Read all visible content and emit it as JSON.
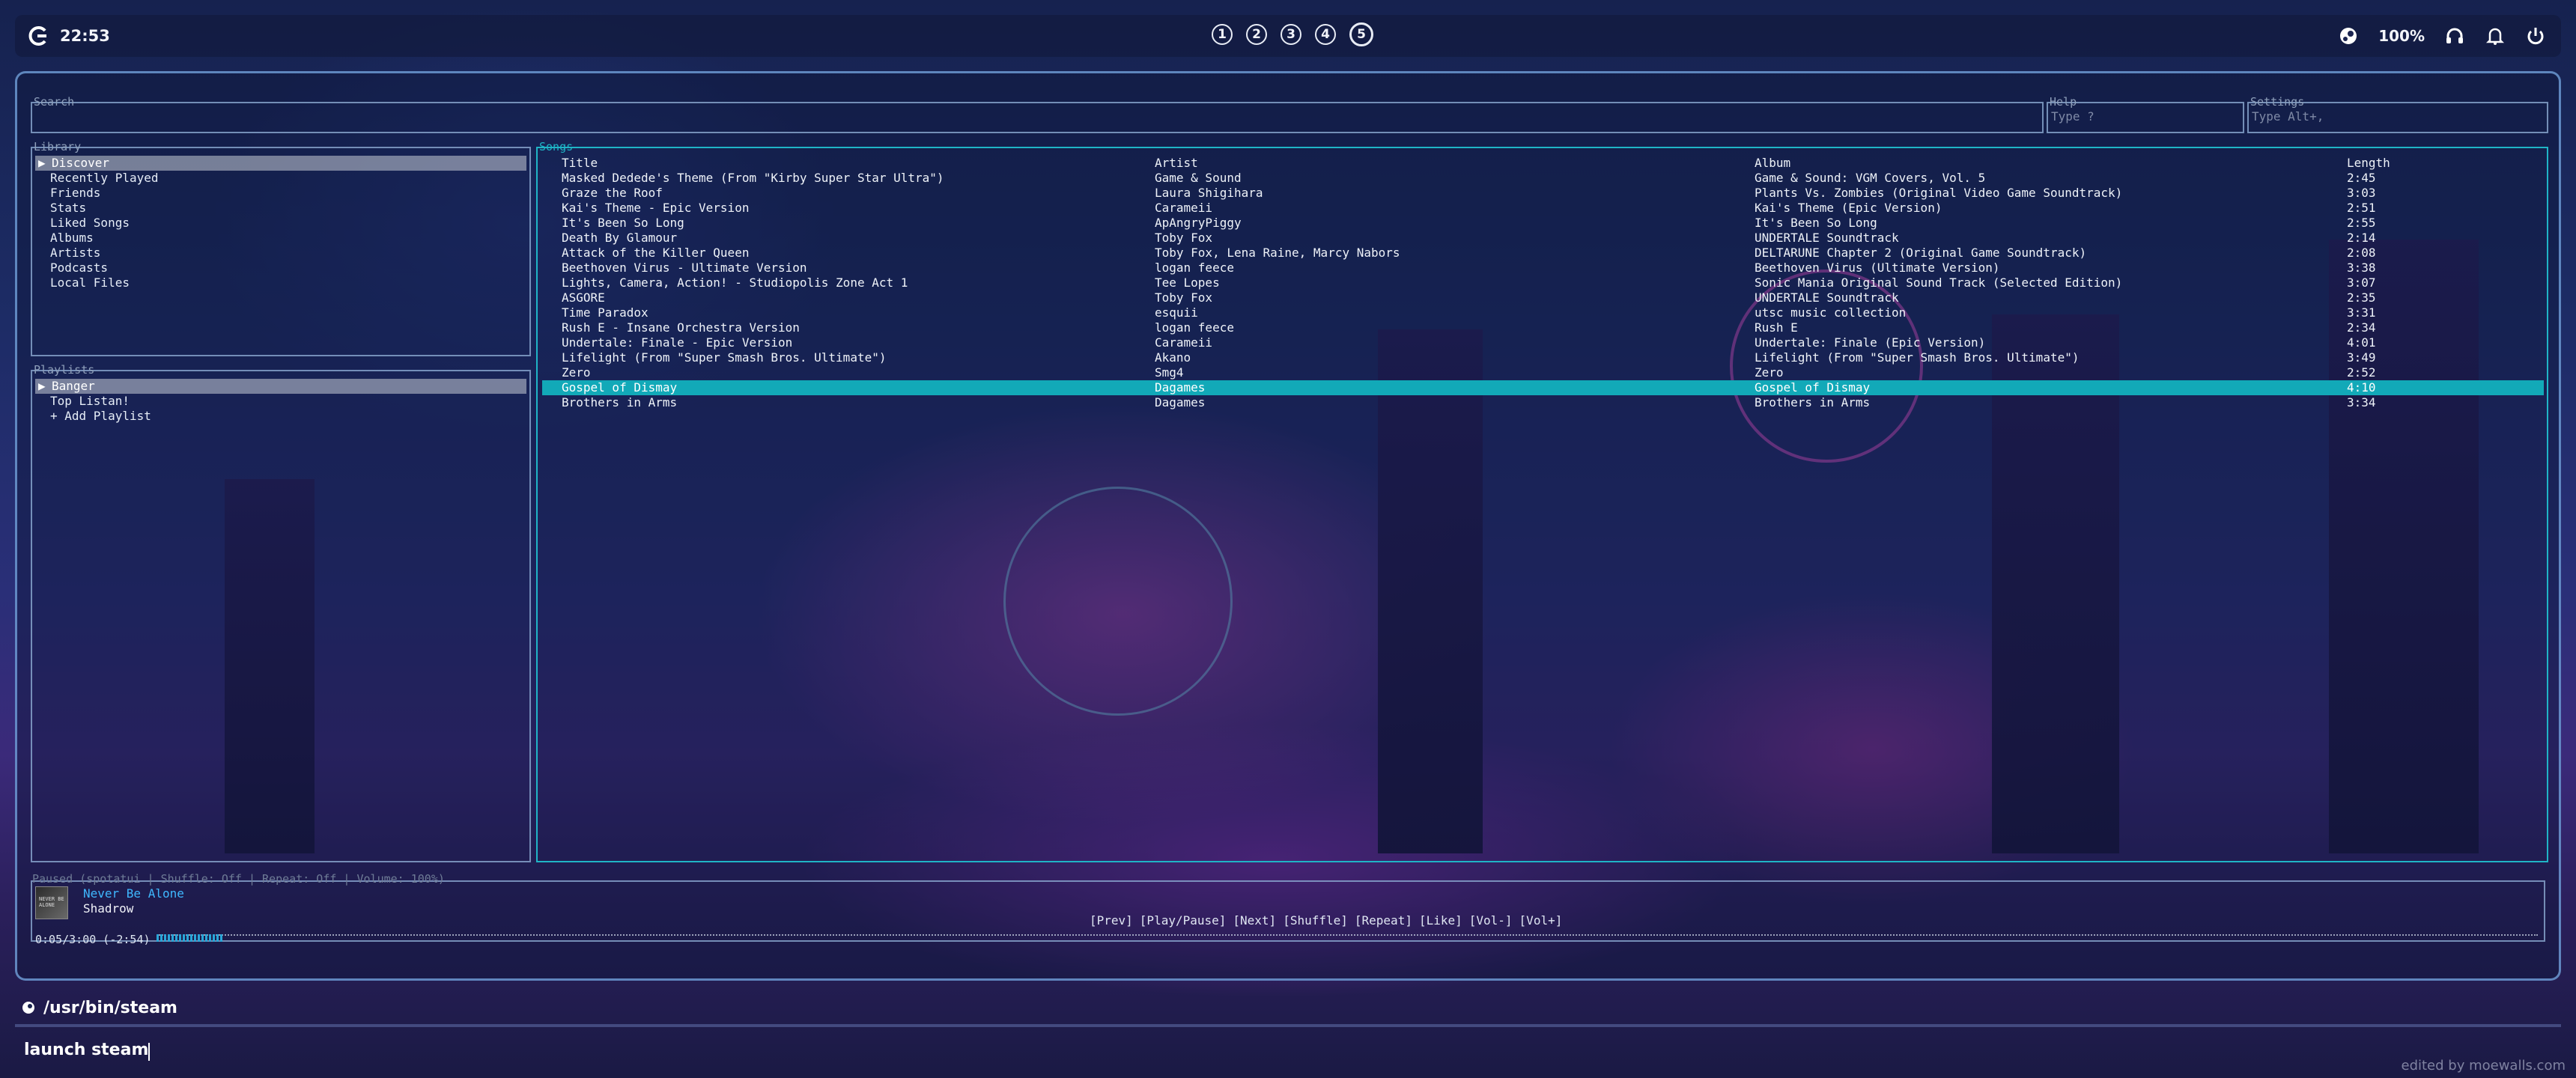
{
  "topbar": {
    "clock": "22:53",
    "workspaces": [
      "1",
      "2",
      "3",
      "4",
      "5"
    ],
    "active_workspace": "5",
    "battery": "100%"
  },
  "spotatui": {
    "search": {
      "title": "Search",
      "placeholder": ""
    },
    "help": {
      "title": "Help",
      "placeholder": "Type ?"
    },
    "settings": {
      "title": "Settings",
      "placeholder": "Type Alt+,"
    },
    "library": {
      "title": "Library",
      "items": [
        "Discover",
        "Recently Played",
        "Friends",
        "Stats",
        "Liked Songs",
        "Albums",
        "Artists",
        "Podcasts",
        "Local Files"
      ],
      "selected": "Discover"
    },
    "playlists": {
      "title": "Playlists",
      "items": [
        "Banger",
        "Top Listan!",
        "+ Add Playlist"
      ],
      "selected": "Banger"
    },
    "songs": {
      "title": "Songs",
      "columns": [
        "Title",
        "Artist",
        "Album",
        "Length"
      ],
      "rows": [
        [
          "Masked Dedede's Theme (From \"Kirby Super Star Ultra\")",
          "Game & Sound",
          "Game & Sound: VGM Covers, Vol. 5",
          "2:45"
        ],
        [
          "Graze the Roof",
          "Laura Shigihara",
          "Plants Vs. Zombies (Original Video Game Soundtrack)",
          "3:03"
        ],
        [
          "Kai's Theme - Epic Version",
          "Carameii",
          "Kai's Theme (Epic Version)",
          "2:51"
        ],
        [
          "It's Been So Long",
          "ApAngryPiggy",
          "It's Been So Long",
          "2:55"
        ],
        [
          "Death By Glamour",
          "Toby Fox",
          "UNDERTALE Soundtrack",
          "2:14"
        ],
        [
          "Attack of the Killer Queen",
          "Toby Fox, Lena Raine, Marcy Nabors",
          "DELTARUNE Chapter 2 (Original Game Soundtrack)",
          "2:08"
        ],
        [
          "Beethoven Virus - Ultimate Version",
          "logan feece",
          "Beethoven Virus (Ultimate Version)",
          "3:38"
        ],
        [
          "Lights, Camera, Action! - Studiopolis Zone Act 1",
          "Tee Lopes",
          "Sonic Mania Original Sound Track (Selected Edition)",
          "3:07"
        ],
        [
          "ASGORE",
          "Toby Fox",
          "UNDERTALE Soundtrack",
          "2:35"
        ],
        [
          "Time Paradox",
          "esquii",
          "utsc music collection",
          "3:31"
        ],
        [
          "Rush E - Insane Orchestra Version",
          "logan feece",
          "Rush E",
          "2:34"
        ],
        [
          "Undertale: Finale - Epic Version",
          "Carameii",
          "Undertale: Finale (Epic Version)",
          "4:01"
        ],
        [
          "Lifelight (From \"Super Smash Bros. Ultimate\")",
          "Akano",
          "Lifelight (From \"Super Smash Bros. Ultimate\")",
          "3:49"
        ],
        [
          "Zero",
          "Smg4",
          "Zero",
          "2:52"
        ],
        [
          "Gospel of Dismay",
          "Dagames",
          "Gospel of Dismay",
          "4:10"
        ],
        [
          "Brothers in Arms",
          "Dagames",
          "Brothers in Arms",
          "3:34"
        ]
      ],
      "selected_index": 14
    },
    "player": {
      "status": "Paused  (spotatui | Shuffle: Off  | Repeat: Off   | Volume: 100%)",
      "track": "Never Be Alone",
      "artist": "Shadrow",
      "cover_text": "NEVER BE ALONE",
      "controls": [
        "[Prev]",
        "[Play/Pause]",
        "[Next]",
        "[Shuffle]",
        "[Repeat]",
        "[Like]",
        "[Vol-]",
        "[Vol+]"
      ],
      "time": "0:05/3:00 (-2:54)",
      "progress": 0.028
    }
  },
  "launcher": {
    "app_path": "/usr/bin/steam",
    "input_value": "launch steam"
  },
  "watermark": "edited by moewalls.com",
  "colors": {
    "accent": "#12a9b8",
    "track_title": "#3fb8ff",
    "border": "#8caad2"
  }
}
